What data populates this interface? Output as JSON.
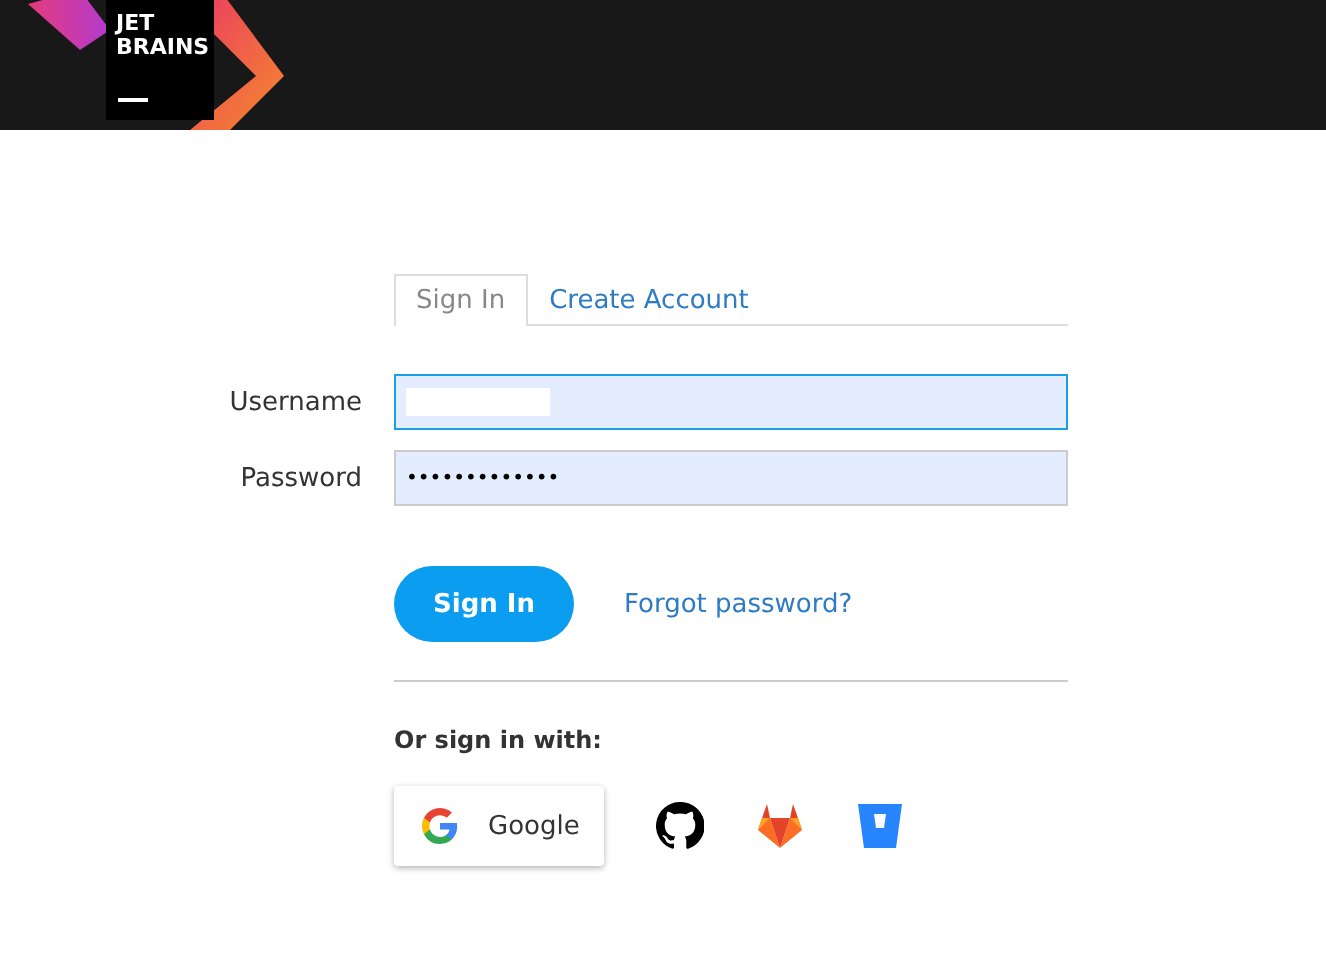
{
  "header": {
    "logo": {
      "line_1": "JET",
      "line_2": "BRAINS"
    }
  },
  "tabs": [
    {
      "label": "Sign In",
      "selected": true
    },
    {
      "label": "Create Account",
      "selected": false
    }
  ],
  "fields": [
    {
      "label": "Username",
      "kind": "redacted",
      "focused": true
    },
    {
      "label": "Password",
      "kind": "password",
      "value": "•••••••••••••",
      "focused": false
    }
  ],
  "sign_in_button": "Sign In",
  "forgot_link": "Forgot password?",
  "social_heading": "Or sign in with:",
  "providers": [
    {
      "kind": "google",
      "label": "Google"
    },
    {
      "kind": "github"
    },
    {
      "kind": "gitlab"
    },
    {
      "kind": "bitbucket"
    }
  ]
}
